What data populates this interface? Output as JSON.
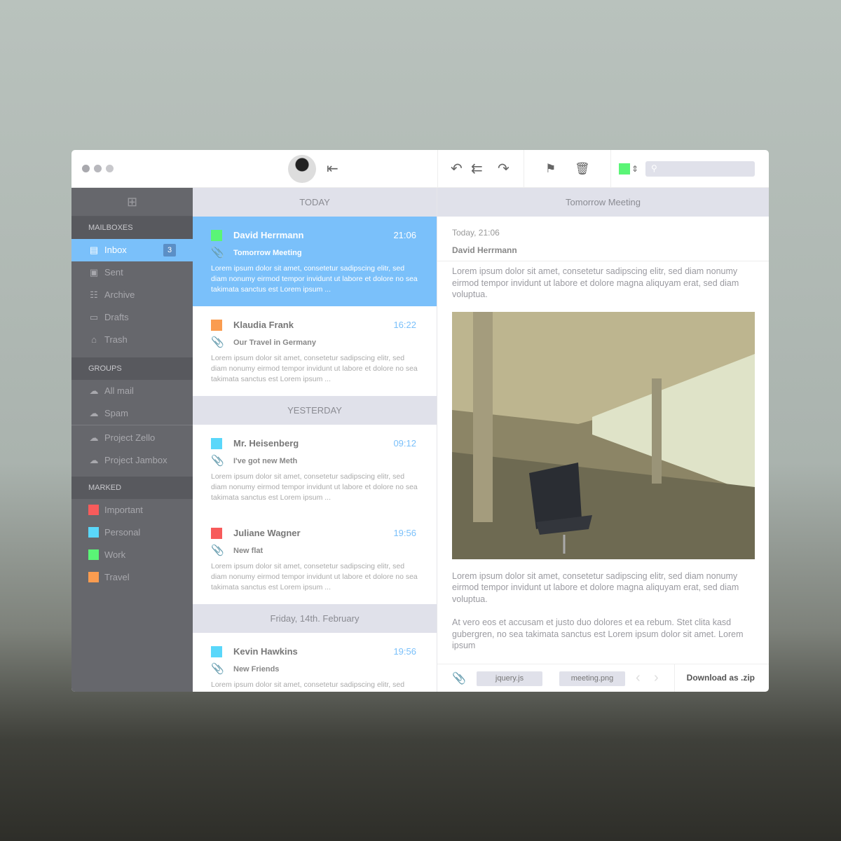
{
  "window": {
    "controls": [
      "close",
      "minimize",
      "maximize"
    ]
  },
  "toolbar": {
    "search_placeholder": "",
    "color_tag": "#5af576"
  },
  "sidebar": {
    "mailboxes_label": "MAILBOXES",
    "mailboxes": [
      {
        "label": "Inbox",
        "badge": "3",
        "icon": "inbox-icon"
      },
      {
        "label": "Sent",
        "icon": "sent-icon"
      },
      {
        "label": "Archive",
        "icon": "archive-icon"
      },
      {
        "label": "Drafts",
        "icon": "folder-icon"
      },
      {
        "label": "Trash",
        "icon": "trash-icon"
      }
    ],
    "groups_label": "GROUPS",
    "groups": [
      {
        "label": "All mail"
      },
      {
        "label": "Spam"
      },
      {
        "label": "Project Zello"
      },
      {
        "label": "Project Jambox"
      }
    ],
    "marked_label": "MARKED",
    "marked": [
      {
        "label": "Important",
        "color": "#f75b5b"
      },
      {
        "label": "Personal",
        "color": "#5ad7fa"
      },
      {
        "label": "Work",
        "color": "#5af576"
      },
      {
        "label": "Travel",
        "color": "#fa9c50"
      }
    ]
  },
  "list": {
    "sections": [
      "TODAY",
      "YESTERDAY",
      "Friday, 14th. February"
    ],
    "preview": "Lorem ipsum dolor sit amet, consetetur sadipscing elitr, sed diam nonumy eirmod tempor invidunt ut labore et dolore no sea takimata sanctus est Lorem ipsum ...",
    "messages": [
      {
        "from": "David Herrmann",
        "time": "21:06",
        "subject": "Tomorrow Meeting",
        "color": "#5af576"
      },
      {
        "from": "Klaudia Frank",
        "time": "16:22",
        "subject": "Our Travel in Germany",
        "color": "#fa9c50"
      },
      {
        "from": "Mr. Heisenberg",
        "time": "09:12",
        "subject": "I've got new Meth",
        "color": "#5ad7fa"
      },
      {
        "from": "Juliane Wagner",
        "time": "19:56",
        "subject": "New flat",
        "color": "#f75b5b"
      },
      {
        "from": "Kevin Hawkins",
        "time": "19:56",
        "subject": "New Friends",
        "color": "#5ad7fa"
      }
    ]
  },
  "reader": {
    "title": "Tomorrow Meeting",
    "date": "Today, 21:06",
    "sender": "David Herrmann",
    "para1": "Lorem ipsum dolor sit amet, consetetur sadipscing elitr, sed diam nonumy eirmod tempor invidunt ut labore et dolore magna aliquyam erat, sed diam voluptua.",
    "para2": "Lorem ipsum dolor sit amet, consetetur sadipscing elitr, sed diam nonumy eirmod tempor invidunt ut labore et dolore magna aliquyam erat, sed diam voluptua.",
    "para3": "At vero eos et accusam et justo duo dolores et ea rebum. Stet clita kasd gubergren, no sea takimata sanctus est Lorem ipsum dolor sit amet. Lorem ipsum",
    "attachments": [
      "jquery.js",
      "meeting.png"
    ],
    "download_label": "Download as .zip"
  }
}
